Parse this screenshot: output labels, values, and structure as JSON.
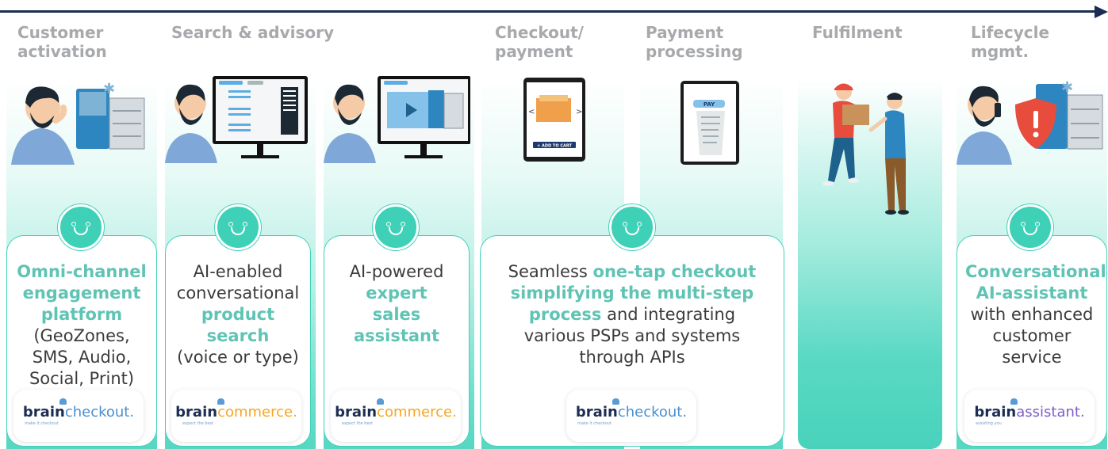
{
  "stages": [
    {
      "title": "Customer\nactivation"
    },
    {
      "title": "Search & advisory"
    },
    {
      "title": "Checkout/\npayment"
    },
    {
      "title": "Payment\nprocessing"
    },
    {
      "title": "Fulfilment"
    },
    {
      "title": "Lifecycle\nmgmt."
    }
  ],
  "cards": [
    {
      "pre": "",
      "highlight": "Omni-channel engagement platform",
      "post": "(GeoZones, SMS, Audio, Social,  Print)"
    },
    {
      "pre": "AI-enabled conversational",
      "highlight": "product search",
      "post": "(voice or type)"
    },
    {
      "pre": "AI-powered",
      "highlight": "expert sales assistant",
      "post": ""
    },
    {
      "pre": "Seamless",
      "highlight": "one-tap checkout simplifying the multi-step process",
      "post": "and integrating various PSPs and systems through APIs"
    },
    {
      "pre": "",
      "highlight": "Conversational AI-assistant",
      "post": "with enhanced customer service"
    }
  ],
  "logos": [
    {
      "brand": "brain",
      "product": "checkout.",
      "product_color": "#4a8fd0",
      "tagline": "make it checkout"
    },
    {
      "brand": "brain",
      "product": "commerce.",
      "product_color": "#f5a623",
      "tagline": "expect the best"
    },
    {
      "brand": "brain",
      "product": "commerce.",
      "product_color": "#f5a623",
      "tagline": "expect the best"
    },
    {
      "brand": "brain",
      "product": "checkout.",
      "product_color": "#4a8fd0",
      "tagline": "make it checkout"
    },
    {
      "brand": "brain",
      "product": "assistant.",
      "product_color": "#7b5fc7",
      "tagline": "assisting you"
    }
  ],
  "mockups": {
    "add_to_cart": "+ ADD TO CART",
    "pay": "PAY"
  },
  "colors": {
    "accent": "#3fd1b8",
    "highlight_text": "#5fc4b4",
    "title_gray": "#a7a9ac",
    "arrow": "#1b2d52"
  }
}
